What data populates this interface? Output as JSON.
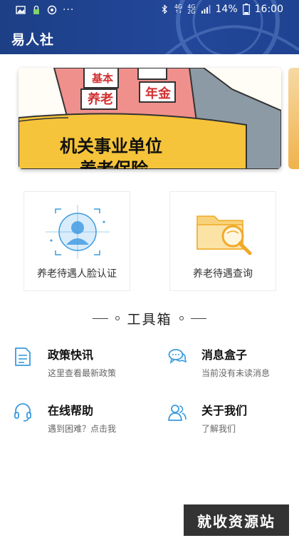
{
  "status_bar": {
    "time": "16:00",
    "battery": "14%",
    "network_top": "4G",
    "network_bottom": "4G",
    "network_sub": "2G",
    "icons": [
      "image-icon",
      "lock-icon",
      "sync-icon",
      "more-dots-icon",
      "bluetooth-icon",
      "signal-icon",
      "battery-icon"
    ]
  },
  "app": {
    "title": "易人社"
  },
  "banner": {
    "sign_texts": [
      "基本",
      "养老",
      "年金"
    ],
    "caption": "机关事业单位",
    "caption_line2": "养老保险"
  },
  "cards": [
    {
      "label": "养老待遇人脸认证",
      "icon": "face-recognition-icon"
    },
    {
      "label": "养老待遇查询",
      "icon": "folder-search-icon"
    }
  ],
  "toolbox": {
    "title": "工具箱",
    "items": [
      {
        "title": "政策快讯",
        "subtitle": "这里查看最新政策",
        "icon": "document-icon"
      },
      {
        "title": "消息盒子",
        "subtitle": "当前没有未读消息",
        "icon": "chat-bubbles-icon"
      },
      {
        "title": "在线帮助",
        "subtitle": "遇到困难？点击我",
        "icon": "headset-icon"
      },
      {
        "title": "关于我们",
        "subtitle": "了解我们",
        "icon": "users-icon"
      }
    ]
  },
  "watermark": {
    "text": "就收资源站"
  },
  "colors": {
    "header": "#23479a",
    "accent_blue": "#3a9be0",
    "accent_orange": "#f0a928"
  }
}
